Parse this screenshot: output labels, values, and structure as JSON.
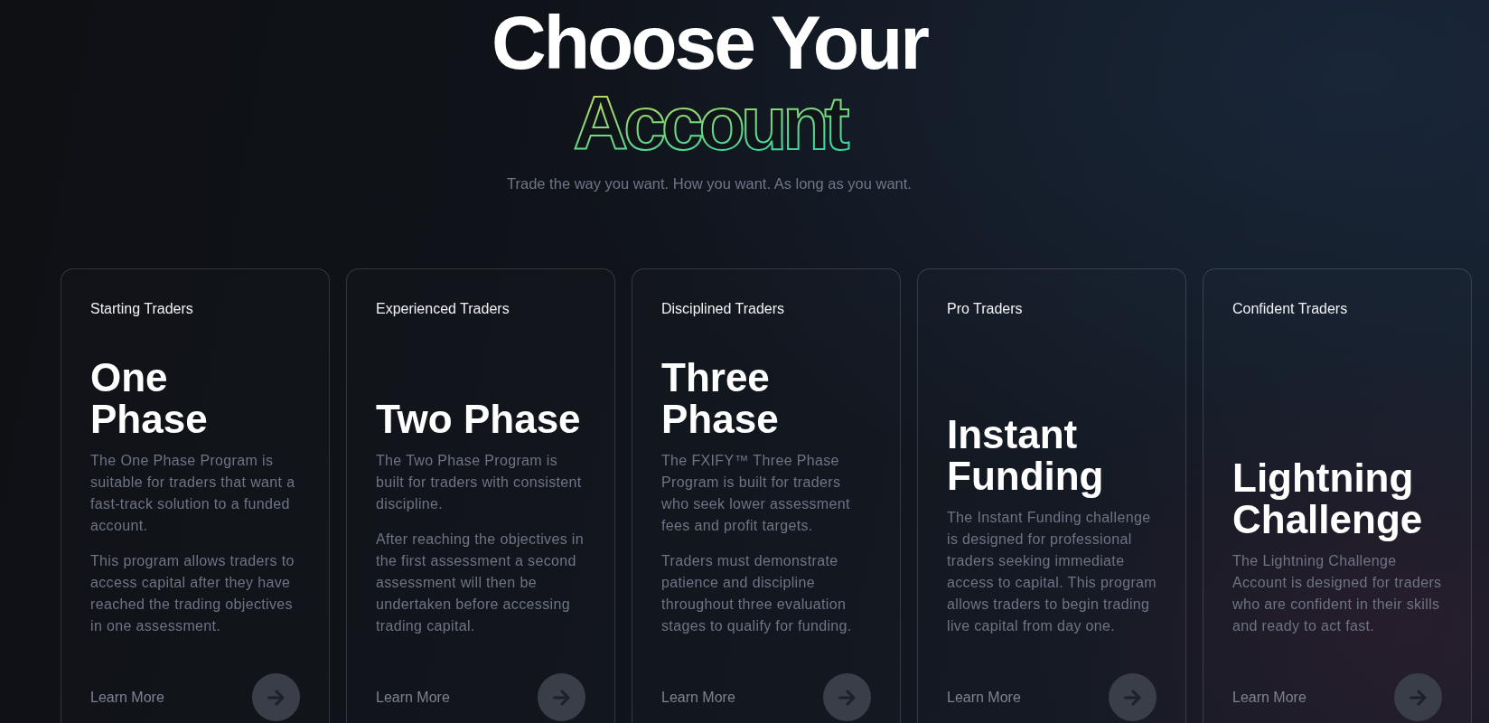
{
  "heading": {
    "title": "Choose Your",
    "accent": "Account",
    "subtitle": "Trade the way you want. How you want. As long as you want."
  },
  "cards": [
    {
      "audience": "Starting Traders",
      "title": "One\nPhase",
      "description": [
        "The One Phase Program is suitable for traders that want a fast-track solution to a funded account.",
        "This program allows traders to access capital after they have reached the trading objectives in one assessment."
      ],
      "link": "Learn More"
    },
    {
      "audience": "Experienced Traders",
      "title": "Two Phase",
      "description": [
        "The Two Phase Program is built for traders with consistent discipline.",
        "After reaching the objectives in the first assessment a second assessment will then be undertaken before accessing trading capital."
      ],
      "link": "Learn More"
    },
    {
      "audience": "Disciplined Traders",
      "title": "Three Phase",
      "description": [
        "The FXIFY™ Three Phase Program is built for traders who seek lower assessment fees and profit targets.",
        "Traders must demonstrate patience and discipline throughout three evaluation stages to qualify for funding."
      ],
      "link": "Learn More"
    },
    {
      "audience": "Pro Traders",
      "title": "Instant Funding",
      "description": [
        "The Instant Funding challenge is designed for professional traders seeking immediate access to capital. This program allows traders to begin trading live capital from day one."
      ],
      "link": "Learn More"
    },
    {
      "audience": "Confident Traders",
      "title": "Lightning Challenge",
      "description": [
        "The Lightning Challenge Account is designed for traders who are confident in their skills and ready to act fast."
      ],
      "link": "Learn More"
    }
  ]
}
